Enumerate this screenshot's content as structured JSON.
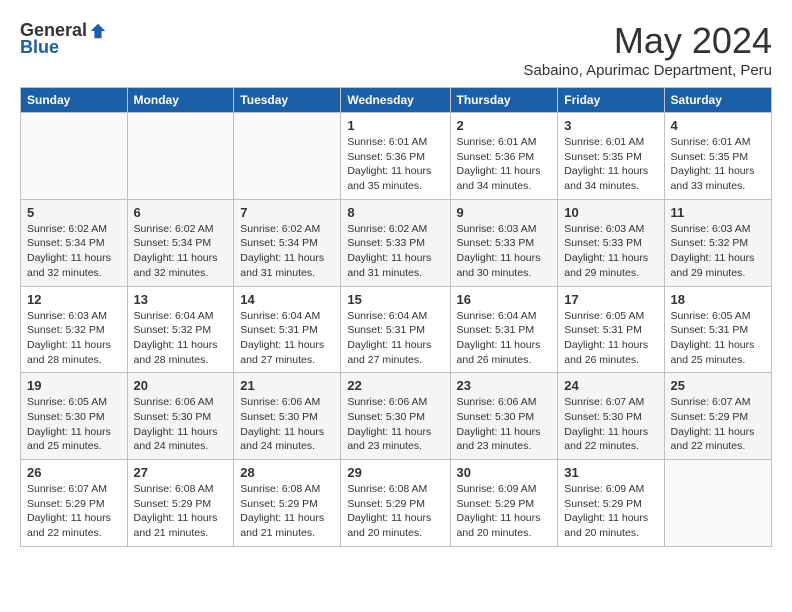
{
  "logo": {
    "general": "General",
    "blue": "Blue"
  },
  "title": "May 2024",
  "subtitle": "Sabaino, Apurimac Department, Peru",
  "days_of_week": [
    "Sunday",
    "Monday",
    "Tuesday",
    "Wednesday",
    "Thursday",
    "Friday",
    "Saturday"
  ],
  "weeks": [
    [
      {
        "day": "",
        "info": ""
      },
      {
        "day": "",
        "info": ""
      },
      {
        "day": "",
        "info": ""
      },
      {
        "day": "1",
        "info": "Sunrise: 6:01 AM\nSunset: 5:36 PM\nDaylight: 11 hours and 35 minutes."
      },
      {
        "day": "2",
        "info": "Sunrise: 6:01 AM\nSunset: 5:36 PM\nDaylight: 11 hours and 34 minutes."
      },
      {
        "day": "3",
        "info": "Sunrise: 6:01 AM\nSunset: 5:35 PM\nDaylight: 11 hours and 34 minutes."
      },
      {
        "day": "4",
        "info": "Sunrise: 6:01 AM\nSunset: 5:35 PM\nDaylight: 11 hours and 33 minutes."
      }
    ],
    [
      {
        "day": "5",
        "info": "Sunrise: 6:02 AM\nSunset: 5:34 PM\nDaylight: 11 hours and 32 minutes."
      },
      {
        "day": "6",
        "info": "Sunrise: 6:02 AM\nSunset: 5:34 PM\nDaylight: 11 hours and 32 minutes."
      },
      {
        "day": "7",
        "info": "Sunrise: 6:02 AM\nSunset: 5:34 PM\nDaylight: 11 hours and 31 minutes."
      },
      {
        "day": "8",
        "info": "Sunrise: 6:02 AM\nSunset: 5:33 PM\nDaylight: 11 hours and 31 minutes."
      },
      {
        "day": "9",
        "info": "Sunrise: 6:03 AM\nSunset: 5:33 PM\nDaylight: 11 hours and 30 minutes."
      },
      {
        "day": "10",
        "info": "Sunrise: 6:03 AM\nSunset: 5:33 PM\nDaylight: 11 hours and 29 minutes."
      },
      {
        "day": "11",
        "info": "Sunrise: 6:03 AM\nSunset: 5:32 PM\nDaylight: 11 hours and 29 minutes."
      }
    ],
    [
      {
        "day": "12",
        "info": "Sunrise: 6:03 AM\nSunset: 5:32 PM\nDaylight: 11 hours and 28 minutes."
      },
      {
        "day": "13",
        "info": "Sunrise: 6:04 AM\nSunset: 5:32 PM\nDaylight: 11 hours and 28 minutes."
      },
      {
        "day": "14",
        "info": "Sunrise: 6:04 AM\nSunset: 5:31 PM\nDaylight: 11 hours and 27 minutes."
      },
      {
        "day": "15",
        "info": "Sunrise: 6:04 AM\nSunset: 5:31 PM\nDaylight: 11 hours and 27 minutes."
      },
      {
        "day": "16",
        "info": "Sunrise: 6:04 AM\nSunset: 5:31 PM\nDaylight: 11 hours and 26 minutes."
      },
      {
        "day": "17",
        "info": "Sunrise: 6:05 AM\nSunset: 5:31 PM\nDaylight: 11 hours and 26 minutes."
      },
      {
        "day": "18",
        "info": "Sunrise: 6:05 AM\nSunset: 5:31 PM\nDaylight: 11 hours and 25 minutes."
      }
    ],
    [
      {
        "day": "19",
        "info": "Sunrise: 6:05 AM\nSunset: 5:30 PM\nDaylight: 11 hours and 25 minutes."
      },
      {
        "day": "20",
        "info": "Sunrise: 6:06 AM\nSunset: 5:30 PM\nDaylight: 11 hours and 24 minutes."
      },
      {
        "day": "21",
        "info": "Sunrise: 6:06 AM\nSunset: 5:30 PM\nDaylight: 11 hours and 24 minutes."
      },
      {
        "day": "22",
        "info": "Sunrise: 6:06 AM\nSunset: 5:30 PM\nDaylight: 11 hours and 23 minutes."
      },
      {
        "day": "23",
        "info": "Sunrise: 6:06 AM\nSunset: 5:30 PM\nDaylight: 11 hours and 23 minutes."
      },
      {
        "day": "24",
        "info": "Sunrise: 6:07 AM\nSunset: 5:30 PM\nDaylight: 11 hours and 22 minutes."
      },
      {
        "day": "25",
        "info": "Sunrise: 6:07 AM\nSunset: 5:29 PM\nDaylight: 11 hours and 22 minutes."
      }
    ],
    [
      {
        "day": "26",
        "info": "Sunrise: 6:07 AM\nSunset: 5:29 PM\nDaylight: 11 hours and 22 minutes."
      },
      {
        "day": "27",
        "info": "Sunrise: 6:08 AM\nSunset: 5:29 PM\nDaylight: 11 hours and 21 minutes."
      },
      {
        "day": "28",
        "info": "Sunrise: 6:08 AM\nSunset: 5:29 PM\nDaylight: 11 hours and 21 minutes."
      },
      {
        "day": "29",
        "info": "Sunrise: 6:08 AM\nSunset: 5:29 PM\nDaylight: 11 hours and 20 minutes."
      },
      {
        "day": "30",
        "info": "Sunrise: 6:09 AM\nSunset: 5:29 PM\nDaylight: 11 hours and 20 minutes."
      },
      {
        "day": "31",
        "info": "Sunrise: 6:09 AM\nSunset: 5:29 PM\nDaylight: 11 hours and 20 minutes."
      },
      {
        "day": "",
        "info": ""
      }
    ]
  ]
}
